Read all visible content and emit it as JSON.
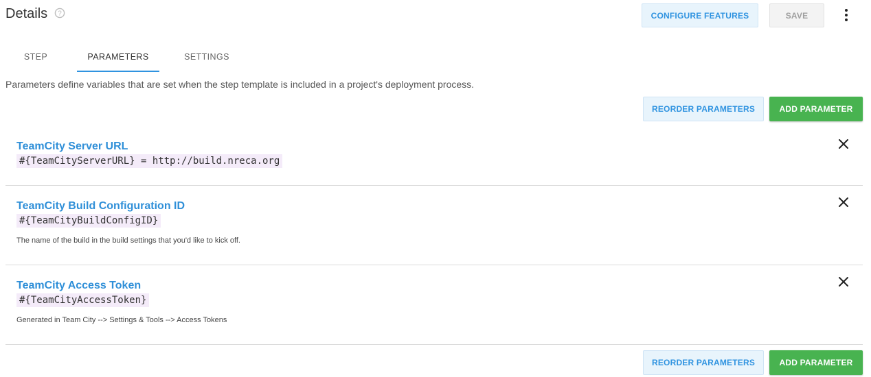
{
  "header": {
    "title": "Details",
    "help_icon": "help-circle-icon",
    "configure_label": "CONFIGURE FEATURES",
    "save_label": "SAVE",
    "more_icon": "more-vertical-icon"
  },
  "tabs": [
    {
      "label": "STEP",
      "active": false
    },
    {
      "label": "PARAMETERS",
      "active": true
    },
    {
      "label": "SETTINGS",
      "active": false
    }
  ],
  "description": "Parameters define variables that are set when the step template is included in a project's deployment process.",
  "actions": {
    "reorder_label": "REORDER PARAMETERS",
    "add_label": "ADD PARAMETER"
  },
  "parameters": [
    {
      "name": "TeamCity Server URL",
      "variable": "#{TeamCityServerURL} = http://build.nreca.org",
      "help": ""
    },
    {
      "name": "TeamCity Build Configuration ID",
      "variable": "#{TeamCityBuildConfigID}",
      "help": "The name of the build in the build settings that you'd like to kick off."
    },
    {
      "name": "TeamCity Access Token",
      "variable": "#{TeamCityAccessToken}",
      "help": "Generated in Team City --> Settings & Tools --> Access Tokens"
    }
  ],
  "colors": {
    "accent": "#2f93e0",
    "primary_button": "#48b350",
    "variable_bg": "#f4ebf9"
  }
}
